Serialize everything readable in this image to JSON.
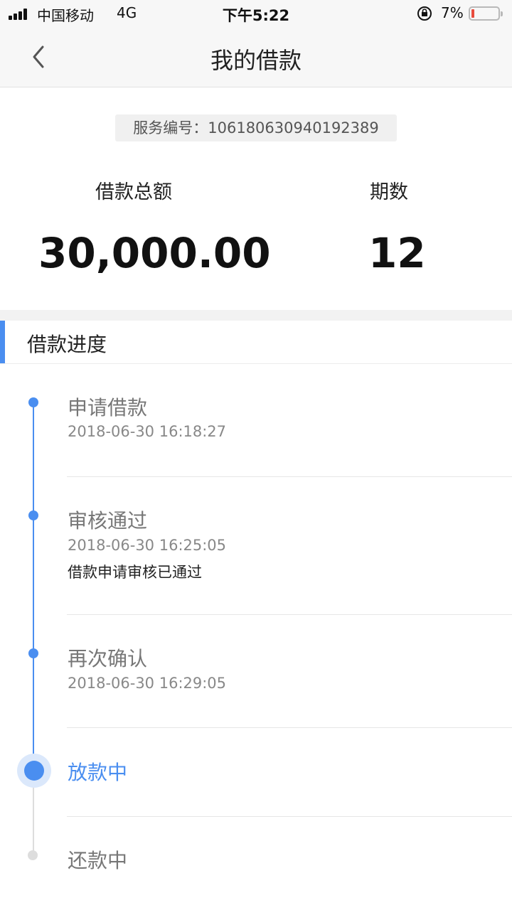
{
  "status_bar": {
    "carrier": "中国移动",
    "network": "4G",
    "time": "下午5:22",
    "battery": "7%"
  },
  "nav": {
    "title": "我的借款",
    "back_icon": "chevron-left-icon"
  },
  "summary": {
    "service_no": "服务编号：106180630940192389",
    "amount_label": "借款总额",
    "amount_value": "30,000.00",
    "terms_label": "期数",
    "terms_value": "12"
  },
  "progress": {
    "title": "借款进度",
    "steps": [
      {
        "title": "申请借款",
        "time": "2018-06-30 16:18:27",
        "note": "",
        "state": "done"
      },
      {
        "title": "审核通过",
        "time": "2018-06-30 16:25:05",
        "note": "借款申请审核已通过",
        "state": "done"
      },
      {
        "title": "再次确认",
        "time": "2018-06-30 16:29:05",
        "note": "",
        "state": "done"
      },
      {
        "title": "放款中",
        "time": "",
        "note": "",
        "state": "current"
      },
      {
        "title": "还款中",
        "time": "",
        "note": "",
        "state": "pending"
      }
    ]
  },
  "colors": {
    "accent": "#4a8ef0",
    "battery_low": "#e84c3d"
  }
}
